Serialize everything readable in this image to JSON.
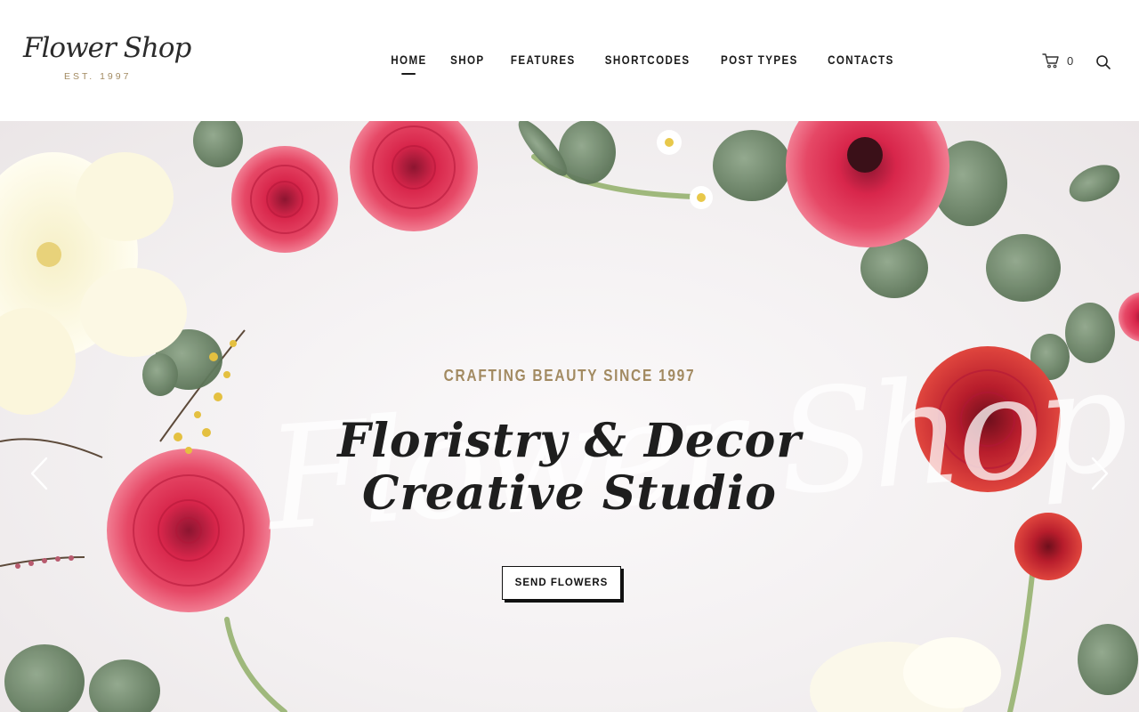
{
  "brand": {
    "name": "Flower Shop",
    "established": "EST. 1997"
  },
  "nav": {
    "items": [
      {
        "label": "HOME",
        "active": true
      },
      {
        "label": "SHOP",
        "active": false
      },
      {
        "label": "FEATURES",
        "active": false
      },
      {
        "label": "SHORTCODES",
        "active": false
      },
      {
        "label": "POST TYPES",
        "active": false
      },
      {
        "label": "CONTACTS",
        "active": false
      }
    ]
  },
  "cart": {
    "icon": "cart-icon",
    "count": "0"
  },
  "search": {
    "icon": "search-icon"
  },
  "hero": {
    "tagline": "CRAFTING BEAUTY SINCE 1997",
    "title_line1": "Floristry & Decor",
    "title_line2": "Creative Studio",
    "watermark": "Flower Shop",
    "button_label": "SEND FLOWERS",
    "prev_icon": "chevron-left-icon",
    "next_icon": "chevron-right-icon"
  },
  "colors": {
    "accent": "#a28a61",
    "text": "#1a1a1a",
    "rose": "#d42a4a",
    "leaf": "#6f8a6a",
    "background": "#f3f0f1"
  }
}
